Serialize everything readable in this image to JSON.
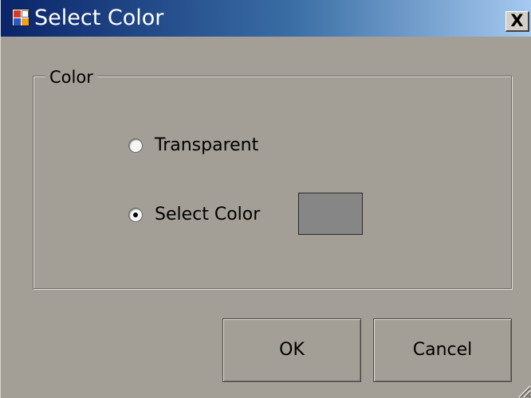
{
  "window": {
    "title": "Select Color",
    "close_glyph": "X",
    "icon": "color-palette-icon"
  },
  "group": {
    "label": "Color"
  },
  "options": [
    {
      "label": "Transparent",
      "checked": false
    },
    {
      "label": "Select Color",
      "checked": true
    }
  ],
  "swatch": {
    "color": "#868686"
  },
  "buttons": {
    "ok": "OK",
    "cancel": "Cancel"
  },
  "colors": {
    "title_gradient_start": "#0a246a",
    "title_gradient_end": "#a6caf0",
    "dialog_background": "#a39e96"
  }
}
